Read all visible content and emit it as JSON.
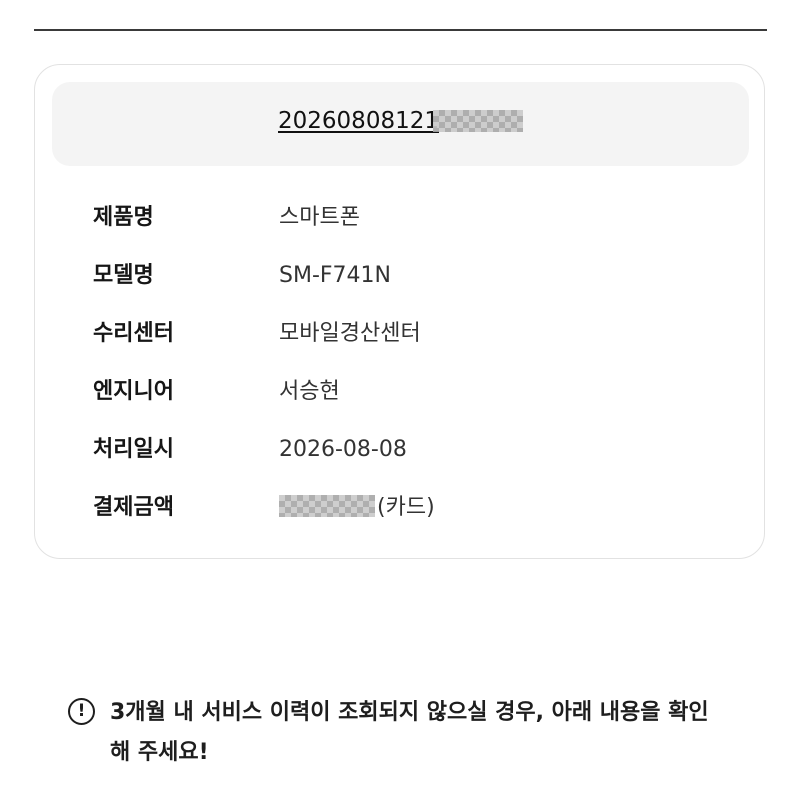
{
  "receipt": {
    "number": "20260808121",
    "number_masked": true
  },
  "details": [
    {
      "label": "제품명",
      "value": "스마트폰"
    },
    {
      "label": "모델명",
      "value": "SM-F741N"
    },
    {
      "label": "수리센터",
      "value": "모바일경산센터"
    },
    {
      "label": "엔지니어",
      "value": "서승현"
    },
    {
      "label": "처리일시",
      "value": "2026-08-08"
    },
    {
      "label": "결제금액",
      "value": "(카드)",
      "amount_masked": true
    }
  ],
  "notice": {
    "icon": "exclamation-circle-icon",
    "icon_glyph": "!",
    "text": "3개월 내 서비스 이력이 조회되지 않으실 경우, 아래 내용을 확인해 주세요!"
  }
}
